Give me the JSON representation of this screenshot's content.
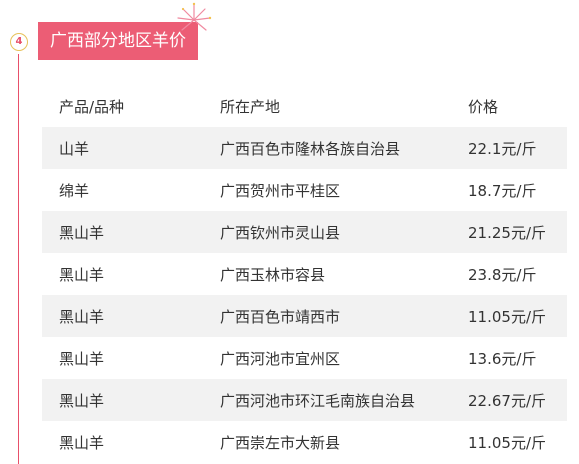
{
  "section": {
    "step_number": "4",
    "title": "广西部分地区羊价"
  },
  "table": {
    "headers": [
      "产品/品种",
      "所在产地",
      "价格"
    ],
    "rows": [
      {
        "product": "山羊",
        "origin": "广西百色市隆林各族自治县",
        "price": "22.1元/斤"
      },
      {
        "product": "绵羊",
        "origin": "广西贺州市平桂区",
        "price": "18.7元/斤"
      },
      {
        "product": "黑山羊",
        "origin": "广西钦州市灵山县",
        "price": "21.25元/斤"
      },
      {
        "product": "黑山羊",
        "origin": "广西玉林市容县",
        "price": "23.8元/斤"
      },
      {
        "product": "黑山羊",
        "origin": "广西百色市靖西市",
        "price": "11.05元/斤"
      },
      {
        "product": "黑山羊",
        "origin": "广西河池市宜州区",
        "price": "13.6元/斤"
      },
      {
        "product": "黑山羊",
        "origin": "广西河池市环江毛南族自治县",
        "price": "22.67元/斤"
      },
      {
        "product": "黑山羊",
        "origin": "广西崇左市大新县",
        "price": "11.05元/斤"
      }
    ]
  },
  "colors": {
    "accent": "#ec5d75",
    "badge_border": "#e7c25a",
    "row_stripe": "#f2f2f2",
    "text": "#333333"
  }
}
